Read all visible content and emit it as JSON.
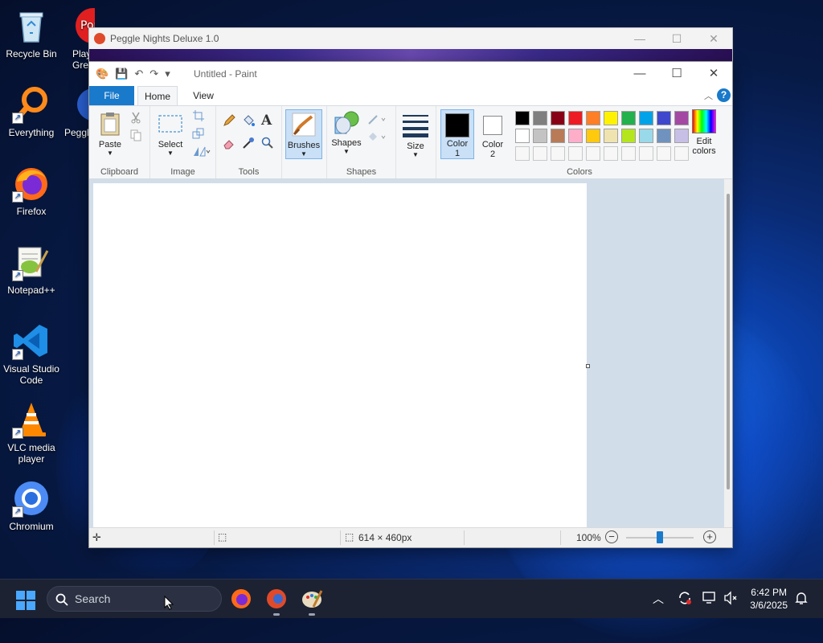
{
  "desktop": {
    "icons": [
      {
        "label": "Recycle Bin"
      },
      {
        "label": "Everything"
      },
      {
        "label": "Firefox"
      },
      {
        "label": "Notepad++"
      },
      {
        "label": "Visual Studio Code"
      },
      {
        "label": "VLC media player"
      },
      {
        "label": "Chromium"
      }
    ],
    "partial_icons": [
      {
        "label": "Play Great"
      },
      {
        "label": "Peggl"
      }
    ]
  },
  "peggle_window": {
    "title": "Peggle Nights Deluxe 1.0"
  },
  "paint": {
    "title": "Untitled - Paint",
    "tabs": {
      "file": "File",
      "home": "Home",
      "view": "View"
    },
    "help": "?",
    "groups": {
      "clipboard": {
        "label": "Clipboard",
        "paste": "Paste"
      },
      "image": {
        "label": "Image",
        "select": "Select"
      },
      "tools": {
        "label": "Tools"
      },
      "brushes": {
        "label": "Brushes"
      },
      "shapes": {
        "label": "Shapes",
        "shapes_btn": "Shapes"
      },
      "size": {
        "label": "Size"
      },
      "colors": {
        "label": "Colors",
        "color1": "Color 1",
        "color2": "Color 2",
        "edit": "Edit colors",
        "palette_row1": [
          "#000000",
          "#7f7f7f",
          "#880015",
          "#ed1c24",
          "#ff7f27",
          "#fff200",
          "#22b14c",
          "#00a2e8",
          "#3f48cc",
          "#a349a4"
        ],
        "palette_row2": [
          "#ffffff",
          "#c3c3c3",
          "#b97a57",
          "#ffaec9",
          "#ffc90e",
          "#efe4b0",
          "#b5e61d",
          "#99d9ea",
          "#7092be",
          "#c8bfe7"
        ]
      }
    },
    "status": {
      "dimensions": "614 × 460px",
      "zoom": "100%"
    }
  },
  "taskbar": {
    "search_placeholder": "Search",
    "time": "6:42 PM",
    "date": "3/6/2025"
  }
}
